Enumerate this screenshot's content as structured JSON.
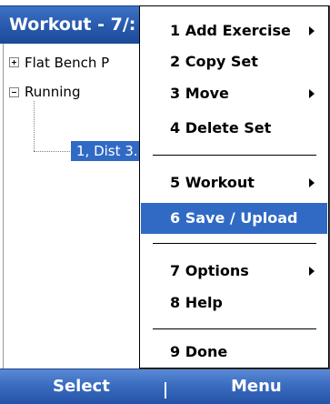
{
  "window": {
    "title": "Workout - 7/:"
  },
  "tree": {
    "items": [
      {
        "label": "Flat Bench P",
        "expanded": false
      },
      {
        "label": "Running",
        "expanded": true
      }
    ],
    "selected_child": {
      "label": "1, Dist 3."
    }
  },
  "menu": {
    "items": [
      {
        "label": "1 Add Exercise",
        "submenu": true
      },
      {
        "label": "2 Copy Set",
        "submenu": false
      },
      {
        "label": "3 Move",
        "submenu": true
      },
      {
        "label": "4 Delete Set",
        "submenu": false
      },
      {
        "label": "5 Workout",
        "submenu": true
      },
      {
        "label": "6 Save / Upload",
        "submenu": false,
        "selected": true
      },
      {
        "label": "7 Options",
        "submenu": true
      },
      {
        "label": "8 Help",
        "submenu": false
      },
      {
        "label": "9 Done",
        "submenu": false
      }
    ]
  },
  "softkeys": {
    "left": "Select",
    "right": "Menu"
  },
  "colors": {
    "title_bar": "#2759ad",
    "selection": "#316ac5",
    "softkey_bar": "#3a6dc0"
  }
}
